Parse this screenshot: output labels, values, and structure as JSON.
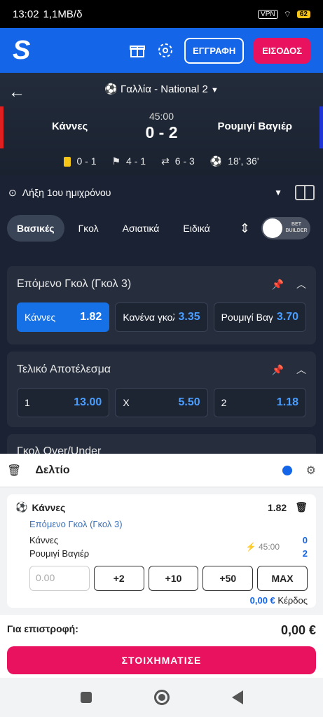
{
  "status": {
    "time": "13:02",
    "speed": "1,1MB/δ",
    "vpn": "VPN",
    "battery": "62"
  },
  "header": {
    "logo": "S",
    "register": "ΕΓΓΡΑΦΗ",
    "login": "ΕΙΣΟΔΟΣ"
  },
  "match": {
    "league": "Γαλλία - National 2",
    "home": "Κάννες",
    "away": "Ρουμιγί  Βαγιέρ",
    "clock": "45:00",
    "score": "0 - 2",
    "cards": "0 - 1",
    "corners": "4 - 1",
    "subs": "6 - 3",
    "goals": "18', 36'"
  },
  "period": "Λήξη 1ου ημιχρόνου",
  "tabs": [
    "Βασικές",
    "Γκολ",
    "Ασιατικά",
    "Ειδικά"
  ],
  "betbuilder": "BET BUILDER",
  "markets": [
    {
      "title": "Επόμενο Γκολ (Γκολ 3)",
      "odds": [
        {
          "label": "Κάννες",
          "value": "1.82"
        },
        {
          "label": "Κανένα γκολ",
          "value": "3.35"
        },
        {
          "label": "Ρουμιγί Βαγιέρ",
          "value": "3.70"
        }
      ]
    },
    {
      "title": "Τελικό Αποτέλεσμα",
      "odds": [
        {
          "label": "1",
          "value": "13.00"
        },
        {
          "label": "X",
          "value": "5.50"
        },
        {
          "label": "2",
          "value": "1.18"
        }
      ]
    },
    {
      "title": "Γκολ Over/Under"
    }
  ],
  "betslip": {
    "title": "Δελτίο",
    "selection": "Κάννες",
    "odd": "1.82",
    "market": "Επόμενο Γκολ (Γκολ 3)",
    "home": "Κάννες",
    "away": "Ρουμιγί Βαγιέρ",
    "time": "45:00",
    "home_score": "0",
    "away_score": "2",
    "stake_placeholder": "0.00",
    "quick": [
      "+2",
      "+10",
      "+50",
      "MAX"
    ],
    "win_amount": "0,00 €",
    "win_label": "Κέρδος"
  },
  "footer": {
    "return_label": "Για επιστροφή:",
    "return_amount": "0,00 €",
    "cta": "ΣΤΟΙΧΗΜΑΤΙΣΕ"
  }
}
